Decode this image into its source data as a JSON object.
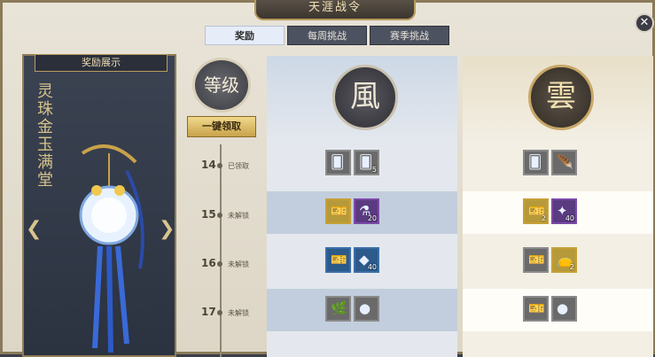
{
  "header": {
    "title": "天涯战令",
    "close_glyph": "✕"
  },
  "tabs": [
    {
      "label": "奖励",
      "active": true
    },
    {
      "label": "每周挑战",
      "active": false
    },
    {
      "label": "赛季挑战",
      "active": false
    }
  ],
  "showcase": {
    "title": "奖励展示",
    "item_name": "灵珠金玉满堂",
    "prev_glyph": "❮",
    "next_glyph": "❯"
  },
  "level_badge": "等级",
  "claim_all_label": "一键领取",
  "tracks": {
    "free_emblem": "風",
    "paid_emblem": "雲"
  },
  "levels": [
    {
      "level": "14",
      "status": "已领取",
      "free": [
        {
          "icon": "card-icon",
          "tone": "grey",
          "glyph": "🂠",
          "qty": ""
        },
        {
          "icon": "card-icon",
          "tone": "grey",
          "glyph": "🂠",
          "qty": "5"
        }
      ],
      "paid": [
        {
          "icon": "card-icon",
          "tone": "grey",
          "glyph": "🂠",
          "qty": ""
        },
        {
          "icon": "scroll-icon",
          "tone": "grey",
          "glyph": "🪶",
          "qty": ""
        }
      ]
    },
    {
      "level": "15",
      "status": "未解锁",
      "free": [
        {
          "icon": "ticket-icon",
          "tone": "gold",
          "glyph": "🎫",
          "qty": ""
        },
        {
          "icon": "potion-icon",
          "tone": "purple",
          "glyph": "⚗",
          "qty": "20"
        }
      ],
      "paid": [
        {
          "icon": "ticket-icon",
          "tone": "gold",
          "glyph": "🎫",
          "qty": "2"
        },
        {
          "icon": "material-icon",
          "tone": "purple",
          "glyph": "✦",
          "qty": "40"
        }
      ]
    },
    {
      "level": "16",
      "status": "未解锁",
      "free": [
        {
          "icon": "ticket-icon",
          "tone": "blue",
          "glyph": "🎫",
          "qty": ""
        },
        {
          "icon": "gem-icon",
          "tone": "blue",
          "glyph": "◆",
          "qty": "40"
        }
      ],
      "paid": [
        {
          "icon": "ticket-icon",
          "tone": "grey",
          "glyph": "🎫",
          "qty": ""
        },
        {
          "icon": "pouch-icon",
          "tone": "gold",
          "glyph": "👝",
          "qty": "2"
        }
      ]
    },
    {
      "level": "17",
      "status": "未解锁",
      "free": [
        {
          "icon": "herb-icon",
          "tone": "grey",
          "glyph": "🌿",
          "qty": ""
        },
        {
          "icon": "coin-icon",
          "tone": "grey",
          "glyph": "●",
          "qty": ""
        }
      ],
      "paid": [
        {
          "icon": "ticket-icon",
          "tone": "grey",
          "glyph": "🎫",
          "qty": ""
        },
        {
          "icon": "coin-icon",
          "tone": "grey",
          "glyph": "●",
          "qty": ""
        }
      ]
    }
  ]
}
